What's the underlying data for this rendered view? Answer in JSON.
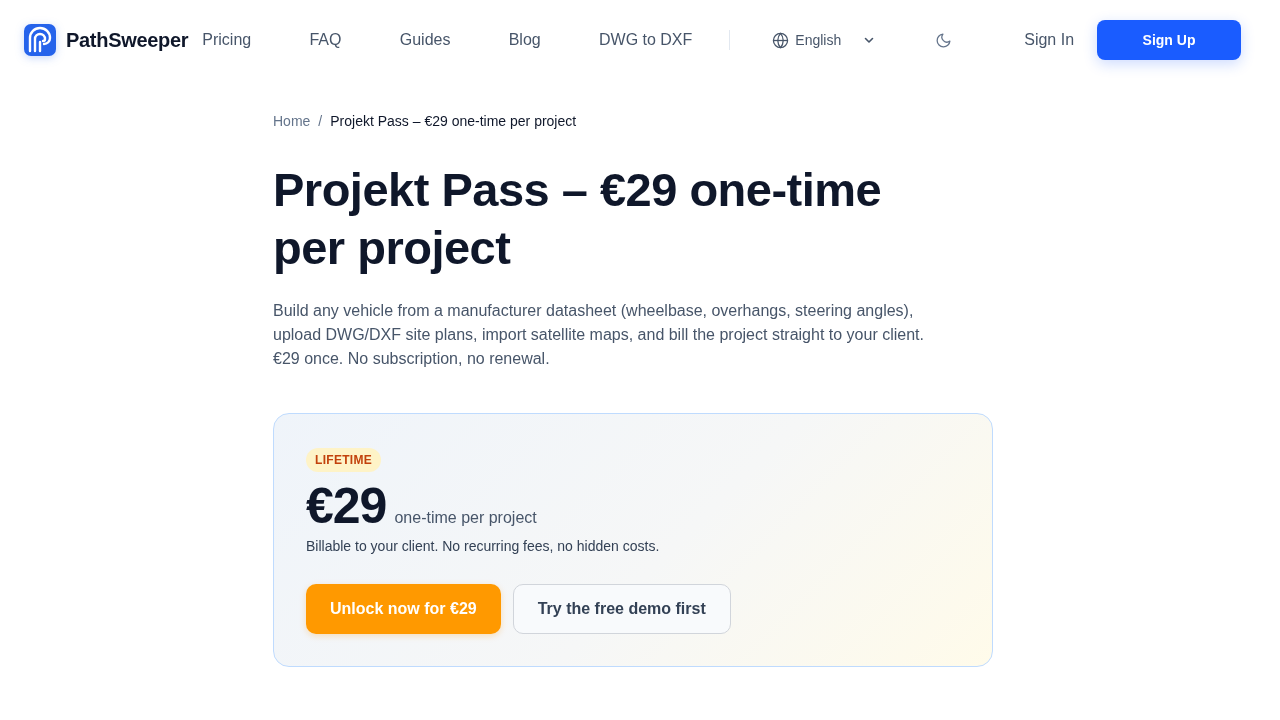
{
  "header": {
    "brand": "PathSweeper",
    "nav": [
      {
        "label": "Pricing"
      },
      {
        "label": "FAQ"
      },
      {
        "label": "Guides"
      },
      {
        "label": "Blog"
      },
      {
        "label": "DWG to DXF"
      }
    ],
    "language": "English",
    "sign_in": "Sign In",
    "sign_up": "Sign Up"
  },
  "breadcrumb": {
    "separator": "/",
    "items": [
      {
        "label": "Home",
        "current": false
      },
      {
        "label": "Projekt Pass – €29 one-time per project",
        "current": true
      }
    ]
  },
  "title": "Projekt Pass – €29 one-time per project",
  "description": "Build any vehicle from a manufacturer datasheet (wheelbase, overhangs, steering angles), upload DWG/DXF site plans, import satellite maps, and bill the project straight to your client. €29 once. No subscription, no renewal.",
  "pricing_card": {
    "badge": "LIFETIME",
    "price": "€29",
    "price_note": "one-time per project",
    "subtext": "Billable to your client. No recurring fees, no hidden costs.",
    "buttons": [
      {
        "label": "Unlock now for €29",
        "kind": "primary"
      },
      {
        "label": "Try the free demo first",
        "kind": "secondary"
      }
    ]
  }
}
